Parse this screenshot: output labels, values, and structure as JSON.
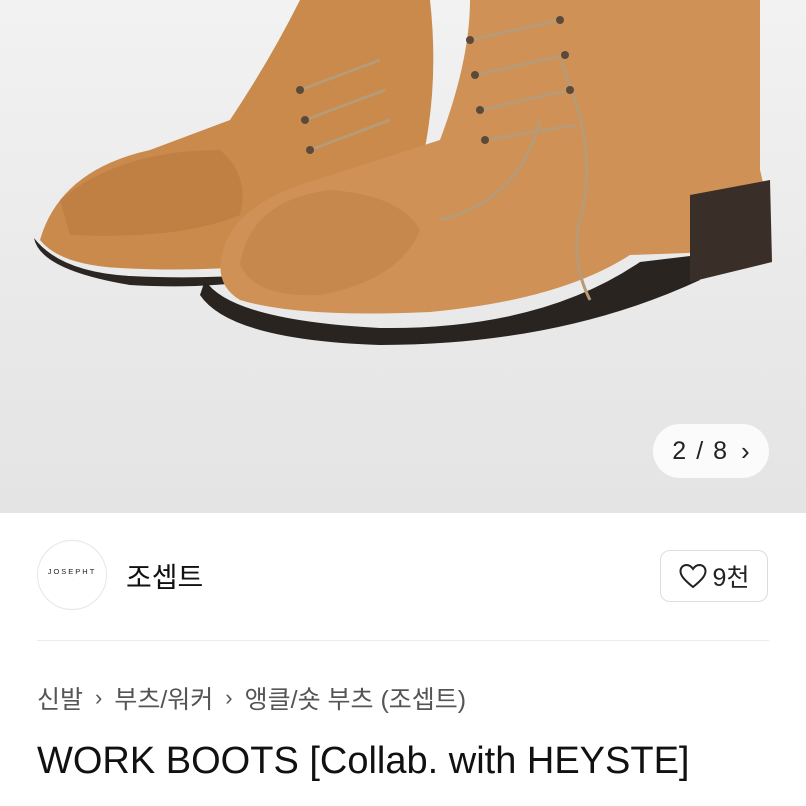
{
  "gallery": {
    "current": "2",
    "separator": "/",
    "total": "8",
    "next_icon": "chevron-right-icon"
  },
  "seller": {
    "logo_text": "JOSEPHT",
    "name": "조셉트"
  },
  "like": {
    "icon": "heart-outline-icon",
    "count": "9천"
  },
  "breadcrumb": {
    "items": [
      "신발",
      "부츠/워커",
      "앵클/숏 부츠 (조셉트)"
    ]
  },
  "product": {
    "title": "WORK BOOTS [Collab. with HEYSTE]"
  }
}
